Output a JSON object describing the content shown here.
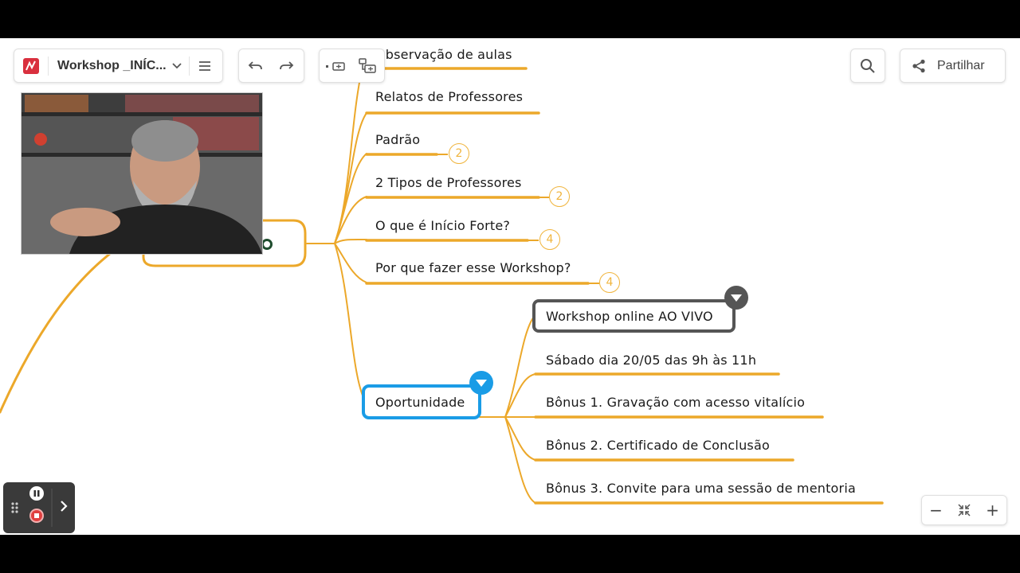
{
  "header": {
    "doc_title": "Workshop _INÍC...",
    "share_label": "Partilhar"
  },
  "icons": {
    "logo": "mindmeister-logo",
    "menu": "hamburger-menu-icon",
    "undo": "undo-icon",
    "redo": "redo-icon",
    "search": "search-icon",
    "share": "share-icon"
  },
  "colors": {
    "branch": "#eca82a",
    "selected": "#1a9ce6",
    "dark_node": "#555555",
    "logo": "#d9303e"
  },
  "mindmap": {
    "nodes": [
      {
        "id": "observacao",
        "label": "Observação de aulas"
      },
      {
        "id": "relatos",
        "label": "Relatos de Professores"
      },
      {
        "id": "padrao",
        "label": "Padrão",
        "badge": "2"
      },
      {
        "id": "tipos",
        "label": "2 Tipos de Professores",
        "badge": "2"
      },
      {
        "id": "inicio",
        "label": "O que é Início Forte?",
        "badge": "4"
      },
      {
        "id": "porque",
        "label": "Por que fazer esse Workshop?",
        "badge": "4"
      },
      {
        "id": "oportunidade",
        "label": "Oportunidade"
      }
    ],
    "sub_nodes": [
      {
        "id": "online",
        "label": "Workshop online AO VIVO"
      },
      {
        "id": "sabado",
        "label": "Sábado dia 20/05 das 9h às 11h"
      },
      {
        "id": "bonus1",
        "label": "Bônus 1. Gravação com acesso vitalício"
      },
      {
        "id": "bonus2",
        "label": "Bônus 2. Certificado de Conclusão"
      },
      {
        "id": "bonus3",
        "label": "Bônus 3. Convite para uma sessão de mentoria"
      }
    ]
  },
  "zoom": {
    "minus": "−",
    "plus": "+"
  }
}
